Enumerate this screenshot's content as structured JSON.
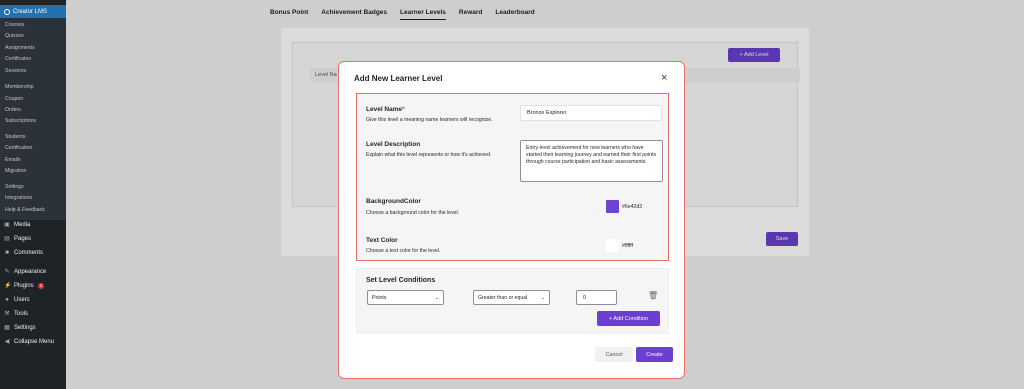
{
  "sidebar": {
    "plugin_label": "Creator LMS",
    "sub_items": [
      "Courses",
      "Quizzes",
      "Assignments",
      "Certificates",
      "Sessions",
      "Membership",
      "Coupon",
      "Orders",
      "Subscriptions",
      "Students",
      "Certification",
      "Emails",
      "Migration",
      "Settings",
      "Integrations",
      "Help & Feedback"
    ],
    "main_items": [
      {
        "label": "Media",
        "icon": "media-icon"
      },
      {
        "label": "Pages",
        "icon": "pages-icon"
      },
      {
        "label": "Comments",
        "icon": "comments-icon"
      },
      {
        "label": "Appearance",
        "icon": "appearance-icon"
      },
      {
        "label": "Plugins",
        "icon": "plugins-icon",
        "badge": "1"
      },
      {
        "label": "Users",
        "icon": "users-icon"
      },
      {
        "label": "Tools",
        "icon": "tools-icon"
      },
      {
        "label": "Settings",
        "icon": "settings-icon"
      },
      {
        "label": "Collapse Menu",
        "icon": "collapse-icon"
      }
    ]
  },
  "tabs": [
    "Bonus Point",
    "Achievement Badges",
    "Learner Levels",
    "Reward",
    "Leaderboard"
  ],
  "background": {
    "add_level": "+ Add Level",
    "column_header": "Level Na",
    "save": "Save"
  },
  "modal": {
    "title": "Add New Learner Level",
    "close": "×",
    "level_name": {
      "label": "Level Name",
      "required": "*",
      "help": "Give this level a meaning name learners will recognize.",
      "value": "Bronze Explorer"
    },
    "level_description": {
      "label": "Level Description",
      "help": "Explain what this level represents or how it's achieved.",
      "value": "Entry-level achievement for new learners who have started their learning journey and earned their first points through course participation and basic assessments."
    },
    "background_color": {
      "label": "BackgroundColor",
      "help": "Choose a background color for the level.",
      "value": "#6e42d3"
    },
    "text_color": {
      "label": "Text Color",
      "help": "Choose a text color for the level.",
      "value": "#ffffff"
    },
    "conditions": {
      "title": "Set Level Conditions",
      "type": "Points",
      "operator": "Greater than or equal",
      "value": "0",
      "add_condition": "+ Add Condition"
    },
    "cancel": "Cancel",
    "create": "Create"
  }
}
